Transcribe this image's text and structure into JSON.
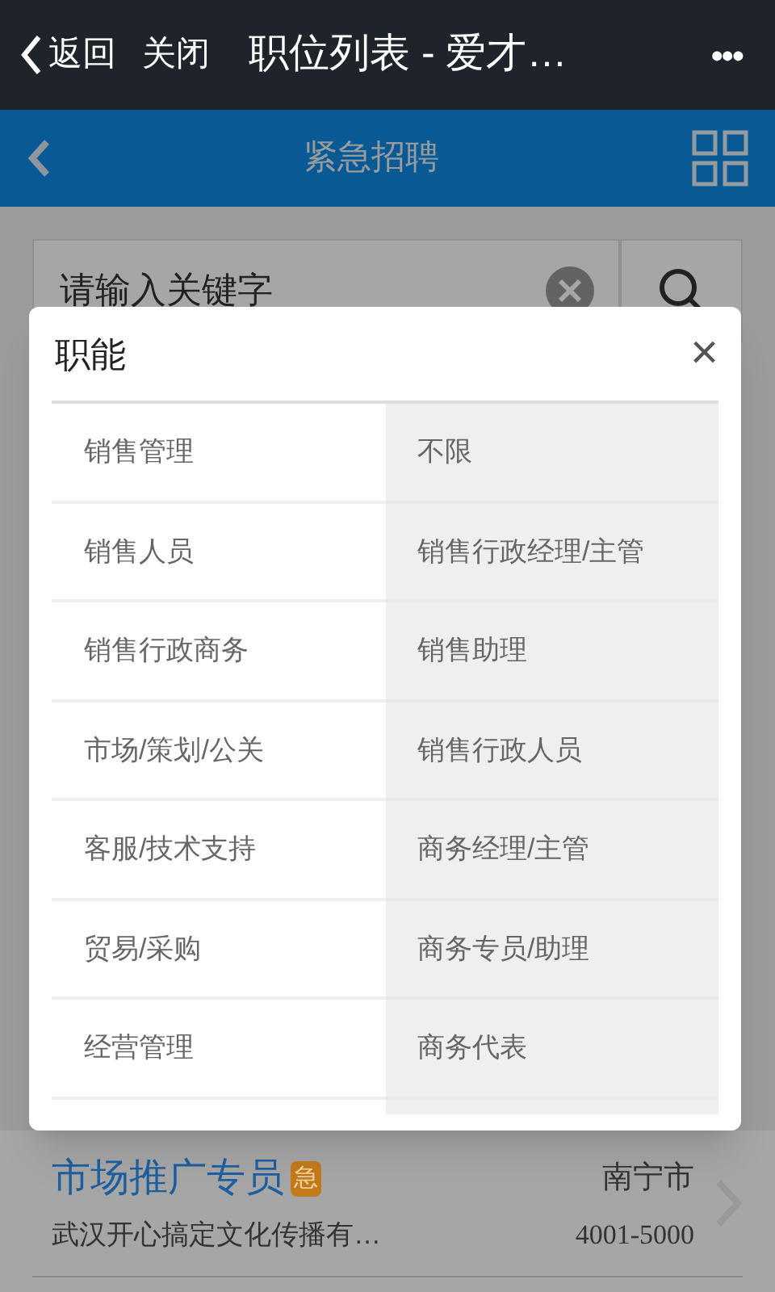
{
  "top_bar": {
    "back": "返回",
    "close": "关闭",
    "title": "职位列表 - 爱才…",
    "more": "•••"
  },
  "nav_bar": {
    "title": "紧急招聘"
  },
  "search": {
    "placeholder": "请输入关键字"
  },
  "dialog": {
    "title": "职能",
    "close": "×",
    "categories": [
      "销售管理",
      "销售人员",
      "销售行政商务",
      "市场/策划/公关",
      "客服/技术支持",
      "贸易/采购",
      "经营管理"
    ],
    "subcategories": [
      "不限",
      "销售行政经理/主管",
      "销售助理",
      "销售行政人员",
      "商务经理/主管",
      "商务专员/助理",
      "商务代表"
    ]
  },
  "jobs": [
    {
      "title": "市场推广专员",
      "badge": "急",
      "city": "南宁市",
      "company": "武汉开心搞定文化传播有…",
      "salary": "4001-5000"
    }
  ]
}
